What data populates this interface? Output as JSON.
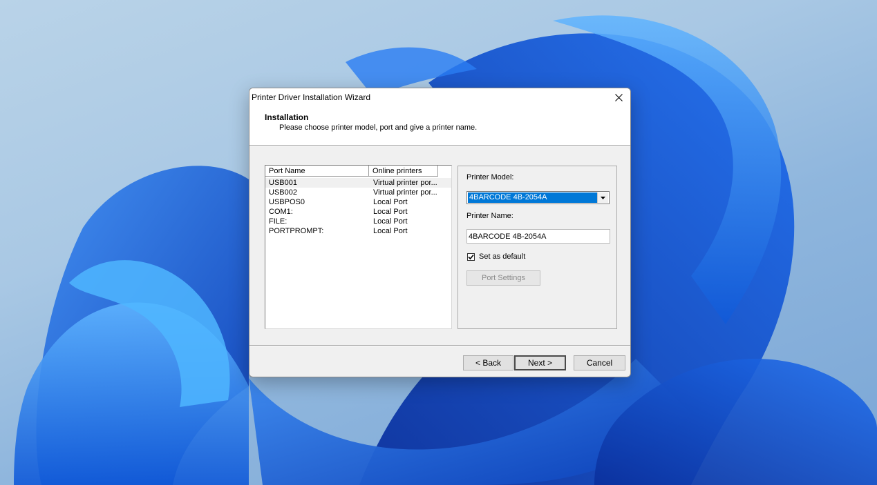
{
  "dialog": {
    "title": "Printer Driver Installation Wizard",
    "header_title": "Installation",
    "header_subtitle": "Please choose printer model, port and give a printer name."
  },
  "ports": {
    "columns": [
      "Port Name",
      "Online printers"
    ],
    "rows": [
      {
        "port": "USB001",
        "printer": "Virtual printer por...",
        "selected": true
      },
      {
        "port": "USB002",
        "printer": "Virtual printer por...",
        "selected": false
      },
      {
        "port": "USBPOS0",
        "printer": "Local Port",
        "selected": false
      },
      {
        "port": "COM1:",
        "printer": "Local Port",
        "selected": false
      },
      {
        "port": "FILE:",
        "printer": "Local Port",
        "selected": false
      },
      {
        "port": "PORTPROMPT:",
        "printer": "Local Port",
        "selected": false
      }
    ]
  },
  "settings": {
    "model_label": "Printer Model:",
    "model_value": "4BARCODE 4B-2054A",
    "name_label": "Printer Name:",
    "name_value": "4BARCODE 4B-2054A",
    "default_label": "Set as default",
    "default_checked": true,
    "port_settings_label": "Port Settings"
  },
  "buttons": {
    "back": "< Back",
    "next": "Next >",
    "cancel": "Cancel"
  },
  "colors": {
    "selection": "#0078d7",
    "dialog_bg": "#f0f0f0",
    "wallpaper_blue": "#1a6fe8"
  }
}
